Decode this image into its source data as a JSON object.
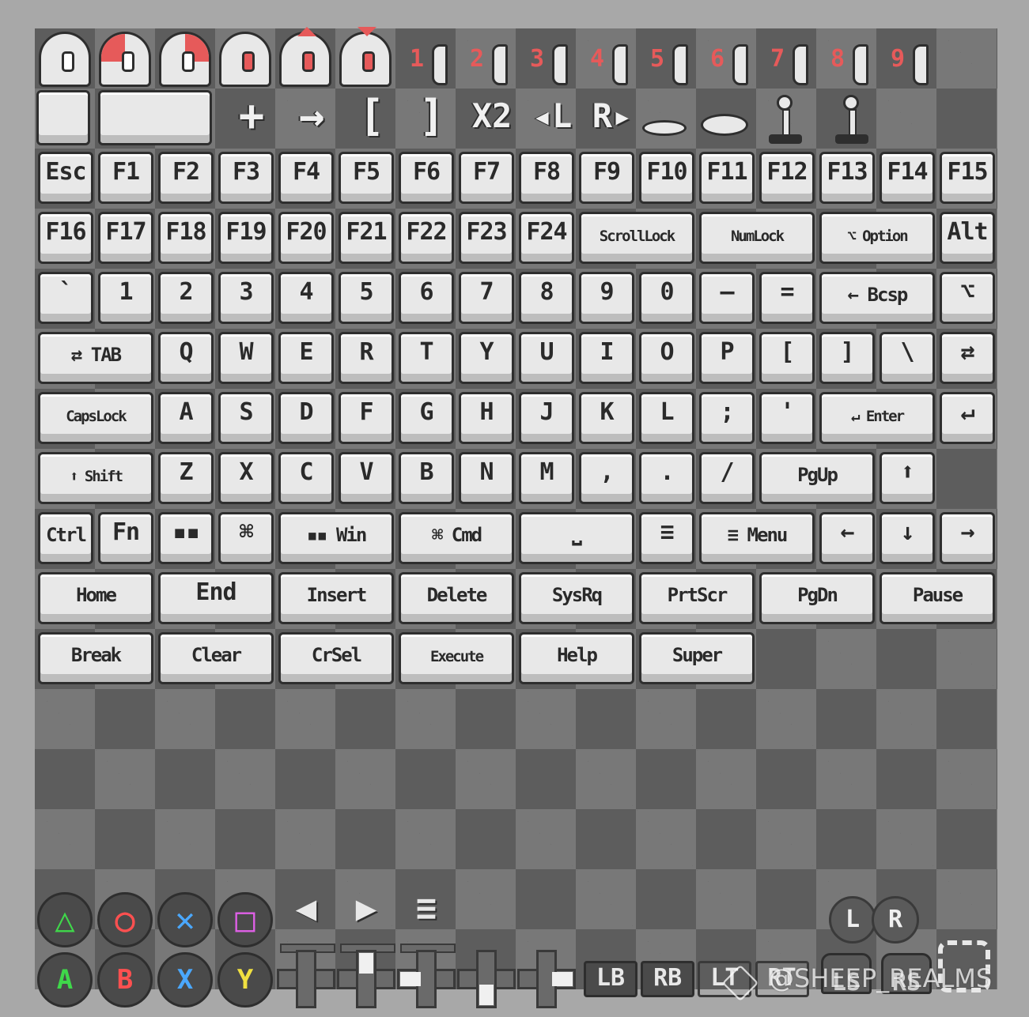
{
  "mouse_row": {
    "mice": [
      {
        "name": "mouse-plain"
      },
      {
        "name": "mouse-left-click",
        "highlight": "left"
      },
      {
        "name": "mouse-right-click",
        "highlight": "right"
      },
      {
        "name": "mouse-wheel",
        "highlight": "wheel"
      },
      {
        "name": "mouse-scroll-up",
        "highlight": "wheel",
        "arrow": "up"
      },
      {
        "name": "mouse-scroll-down",
        "highlight": "wheel",
        "arrow": "down"
      }
    ],
    "buttons": [
      "1",
      "2",
      "3",
      "4",
      "5",
      "6",
      "7",
      "8",
      "9"
    ]
  },
  "symbol_row": {
    "items": [
      "+",
      "→",
      "[",
      "]",
      "X2",
      "◂L",
      "R▸"
    ]
  },
  "keys": {
    "row1": [
      "Esc",
      "F1",
      "F2",
      "F3",
      "F4",
      "F5",
      "F6",
      "F7",
      "F8",
      "F9",
      "F10",
      "F11",
      "F12",
      "F13",
      "F14",
      "F15"
    ],
    "row2": [
      "F16",
      "F17",
      "F18",
      "F19",
      "F20",
      "F21",
      "F22",
      "F23",
      "F24",
      "ScrollLock",
      "NumLock",
      "⌥ Option",
      "Alt"
    ],
    "row3": [
      "`",
      "1",
      "2",
      "3",
      "4",
      "5",
      "6",
      "7",
      "8",
      "9",
      "0",
      "–",
      "=",
      "← Bcsp",
      "⌥"
    ],
    "row4": [
      "⇄ TAB",
      "Q",
      "W",
      "E",
      "R",
      "T",
      "Y",
      "U",
      "I",
      "O",
      "P",
      "[",
      "]",
      "\\",
      "⇄"
    ],
    "row5": [
      "CapsLock",
      "A",
      "S",
      "D",
      "F",
      "G",
      "H",
      "J",
      "K",
      "L",
      ";",
      "'",
      "↵ Enter",
      "↵"
    ],
    "row6": [
      "⬆ Shift",
      "Z",
      "X",
      "C",
      "V",
      "B",
      "N",
      "M",
      ",",
      ".",
      "/",
      "PgUp",
      "⬆"
    ],
    "row7": [
      "Ctrl",
      "Fn",
      "▪▪",
      "⌘",
      "▪▪ Win",
      "⌘ Cmd",
      "⎵",
      "≡",
      "≡ Menu",
      "←",
      "↓",
      "→"
    ],
    "row8": [
      "Home",
      "End",
      "Insert",
      "Delete",
      "SysRq",
      "PrtScr",
      "PgDn",
      "Pause"
    ],
    "row9": [
      "Break",
      "Clear",
      "CrSel",
      "Execute",
      "Help",
      "Super"
    ]
  },
  "gamepad": {
    "shapes": [
      {
        "glyph": "△",
        "color": "#3fd84a"
      },
      {
        "glyph": "○",
        "color": "#ff5050"
      },
      {
        "glyph": "✕",
        "color": "#4aa8ff"
      },
      {
        "glyph": "□",
        "color": "#e060e8"
      }
    ],
    "letters": [
      {
        "glyph": "A",
        "color": "#3fd84a"
      },
      {
        "glyph": "B",
        "color": "#ff5050"
      },
      {
        "glyph": "X",
        "color": "#4aa8ff"
      },
      {
        "glyph": "Y",
        "color": "#f0e040"
      }
    ],
    "arrows": [
      "◀",
      "▶",
      "≡"
    ],
    "sticks": [
      "L",
      "R"
    ],
    "bumpers": [
      "LB",
      "RB",
      "LT",
      "RT"
    ],
    "stick_presses": [
      "LS",
      "RS"
    ]
  },
  "watermark": "@SHEEP_REALMS",
  "colors": {
    "accent_red": "#e65a5a",
    "key_face": "#e8e8e8",
    "outline": "#2e2e2e"
  }
}
